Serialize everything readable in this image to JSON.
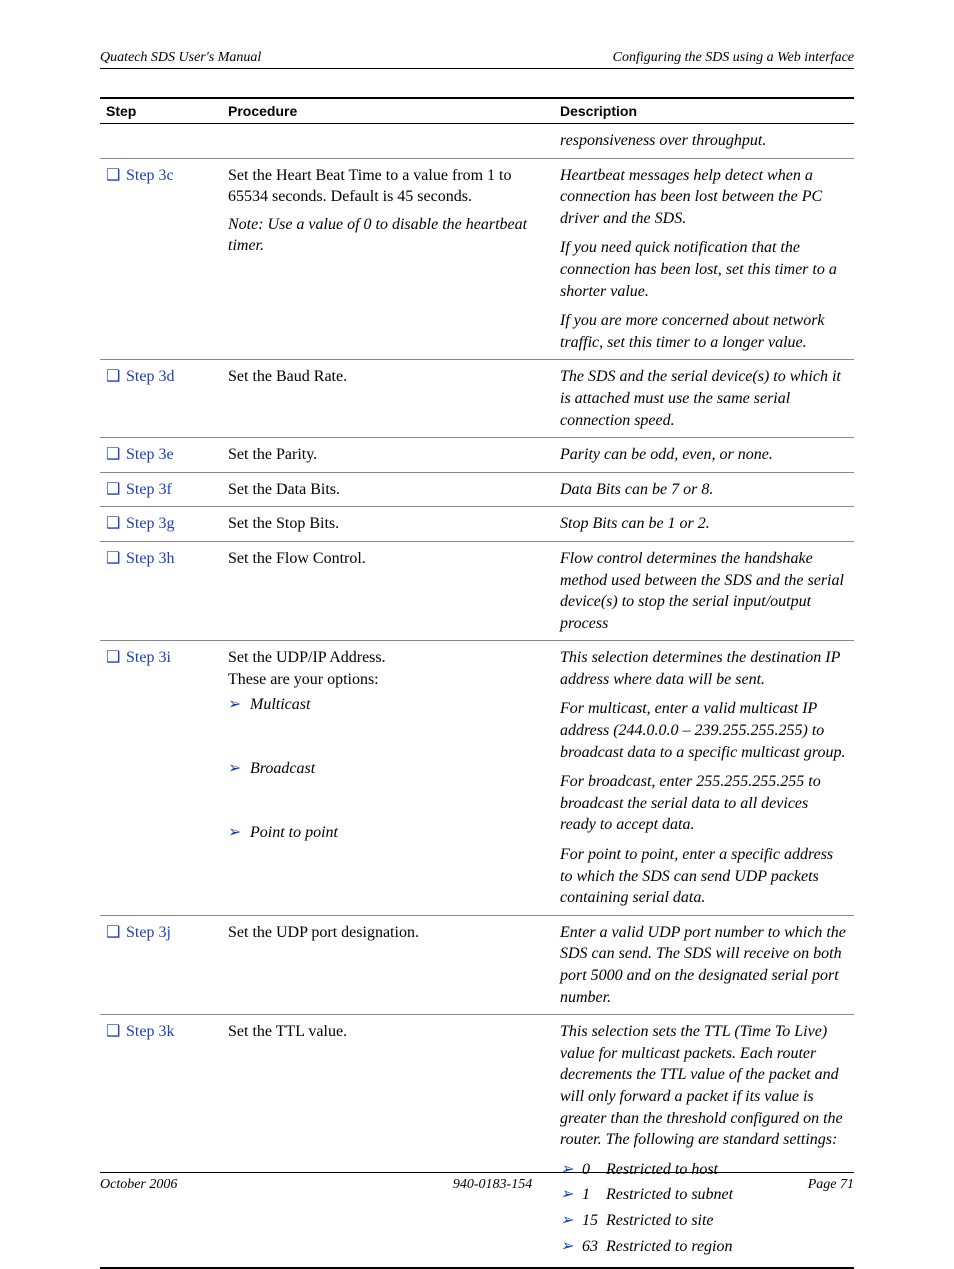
{
  "header": {
    "left": "Quatech SDS User's Manual",
    "right": "Configuring the SDS using a Web interface"
  },
  "columns": {
    "step": "Step",
    "procedure": "Procedure",
    "description": "Description"
  },
  "rows": {
    "prev_desc": "responsiveness over throughput.",
    "s3c": {
      "step": "Step 3c",
      "proc_line1": "Set the Heart Beat Time to a value from 1 to 65534 seconds. Default is 45 seconds.",
      "proc_note": "Note: Use a value of 0 to disable the heartbeat timer.",
      "desc1": "Heartbeat messages help detect when a connection has been lost between the PC driver and the SDS.",
      "desc2": "If you need quick notification that the connection has been lost, set this timer to a shorter value.",
      "desc3": "If you are more concerned about network traffic, set this timer to a longer value."
    },
    "s3d": {
      "step": "Step 3d",
      "proc": "Set the Baud Rate.",
      "desc": "The SDS and the serial device(s) to which it is attached must use the same serial connection speed."
    },
    "s3e": {
      "step": "Step 3e",
      "proc": "Set the Parity.",
      "desc": "Parity can be odd, even, or none."
    },
    "s3f": {
      "step": "Step 3f",
      "proc": "Set the Data Bits.",
      "desc": "Data Bits can be 7 or 8."
    },
    "s3g": {
      "step": "Step 3g",
      "proc": "Set the Stop Bits.",
      "desc": "Stop Bits can be 1 or 2."
    },
    "s3h": {
      "step": "Step 3h",
      "proc": "Set the Flow Control.",
      "desc": "Flow control determines the handshake method used between the SDS and the serial device(s) to stop the serial input/output process"
    },
    "s3i": {
      "step": "Step 3i",
      "proc_intro1": "Set the UDP/IP Address.",
      "proc_intro2": "These are your options:",
      "opt1": "Multicast",
      "opt2": "Broadcast",
      "opt3": "Point to point",
      "desc_intro": "This selection determines the destination IP address where data will be sent.",
      "desc1": "For multicast, enter a valid multicast IP address (244.0.0.0 – 239.255.255.255) to broadcast data to a specific multicast group.",
      "desc2": "For broadcast, enter 255.255.255.255 to broadcast the serial data to all devices ready to accept data.",
      "desc3": "For point to point, enter a specific address to which the SDS can send UDP packets containing serial data."
    },
    "s3j": {
      "step": "Step 3j",
      "proc": "Set the UDP port designation.",
      "desc": "Enter a valid UDP port number to which the SDS can send. The SDS will receive on both port 5000 and on the designated serial port number."
    },
    "s3k": {
      "step": "Step 3k",
      "proc": "Set the TTL value.",
      "desc_intro": "This selection sets the TTL (Time To Live) value for multicast packets. Each router decrements the TTL value of the packet and will only forward a packet if its value is greater than the threshold configured on the router. The following are standard settings:",
      "ttl0_n": "0",
      "ttl0": "Restricted to host",
      "ttl1_n": "1",
      "ttl1": "Restricted to subnet",
      "ttl15_n": "15",
      "ttl15": "Restricted to site",
      "ttl63_n": "63",
      "ttl63": "Restricted to region"
    }
  },
  "footer": {
    "left": "October 2006",
    "center": "940-0183-154",
    "right": "Page 71"
  }
}
